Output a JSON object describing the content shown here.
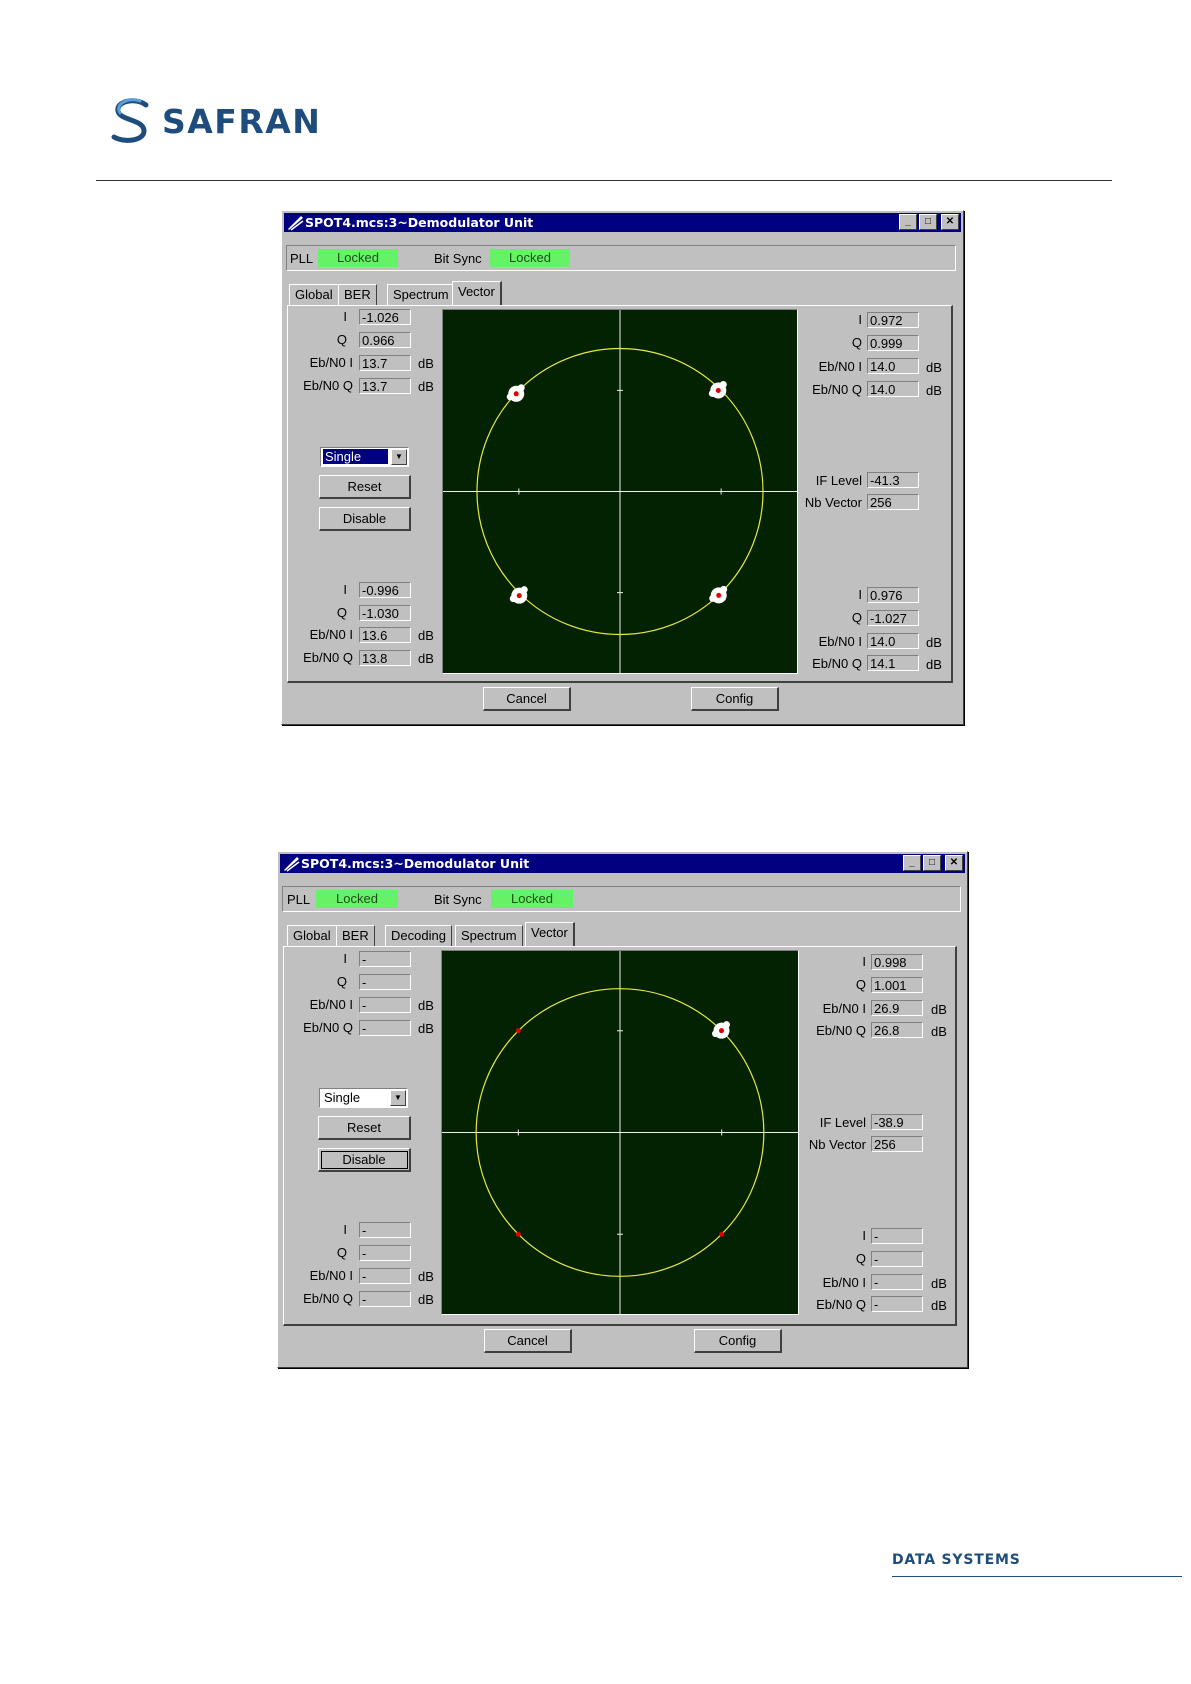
{
  "header": {
    "brand": "SAFRAN"
  },
  "footer": {
    "text": "DATA SYSTEMS"
  },
  "colors": {
    "plot_bg": "#022202",
    "circle": "#e8e840",
    "axis": "#f0f0f0",
    "cluster": "#ffffff",
    "point": "#e00000",
    "locked": "#66f266",
    "titlebar": "#000080"
  },
  "windows": [
    {
      "title": "SPOT4.mcs:3~Demodulator Unit",
      "pll_label": "PLL",
      "pll_status": "Locked",
      "bitsync_label": "Bit Sync",
      "bitsync_status": "Locked",
      "tabs": [
        "Global",
        "BER",
        "Spectrum",
        "Vector"
      ],
      "active_tab": "Vector",
      "top_left": {
        "i_label": "I",
        "i": "-1.026",
        "q_label": "Q",
        "q": "0.966",
        "ebi_label": "Eb/N0 I",
        "ebi": "13.7",
        "ebq_label": "Eb/N0 Q",
        "ebq": "13.7",
        "unit": "dB"
      },
      "top_right": {
        "i_label": "I",
        "i": "0.972",
        "q_label": "Q",
        "q": "0.999",
        "ebi_label": "Eb/N0 I",
        "ebi": "14.0",
        "ebq_label": "Eb/N0 Q",
        "ebq": "14.0",
        "unit": "dB"
      },
      "bottom_left": {
        "i_label": "I",
        "i": "-0.996",
        "q_label": "Q",
        "q": "-1.030",
        "ebi_label": "Eb/N0 I",
        "ebi": "13.6",
        "ebq_label": "Eb/N0 Q",
        "ebq": "13.8",
        "unit": "dB"
      },
      "bottom_right": {
        "i_label": "I",
        "i": "0.976",
        "q_label": "Q",
        "q": "-1.027",
        "ebi_label": "Eb/N0 I",
        "ebi": "14.0",
        "ebq_label": "Eb/N0 Q",
        "ebq": "14.1",
        "unit": "dB"
      },
      "mode_select": "Single",
      "reset_label": "Reset",
      "disable_label": "Disable",
      "if_level_label": "IF Level",
      "if_level": "-41.3",
      "nb_vector_label": "Nb Vector",
      "nb_vector": "256",
      "cancel_label": "Cancel",
      "config_label": "Config",
      "chart_data": {
        "type": "scatter",
        "title": "",
        "xlim": [
          -1.75,
          1.75
        ],
        "ylim": [
          -1.75,
          1.75
        ],
        "reference_circle_radius": 1.414,
        "points": [
          {
            "x": -1.026,
            "y": 0.966,
            "cluster": true
          },
          {
            "x": 0.972,
            "y": 0.999,
            "cluster": true
          },
          {
            "x": -0.996,
            "y": -1.03,
            "cluster": true
          },
          {
            "x": 0.976,
            "y": -1.027,
            "cluster": true
          }
        ]
      }
    },
    {
      "title": "SPOT4.mcs:3~Demodulator Unit",
      "pll_label": "PLL",
      "pll_status": "Locked",
      "bitsync_label": "Bit Sync",
      "bitsync_status": "Locked",
      "tabs": [
        "Global",
        "BER",
        "Decoding",
        "Spectrum",
        "Vector"
      ],
      "active_tab": "Vector",
      "top_left": {
        "i_label": "I",
        "i": "-",
        "q_label": "Q",
        "q": "-",
        "ebi_label": "Eb/N0 I",
        "ebi": "-",
        "ebq_label": "Eb/N0 Q",
        "ebq": "-",
        "unit": "dB"
      },
      "top_right": {
        "i_label": "I",
        "i": "0.998",
        "q_label": "Q",
        "q": "1.001",
        "ebi_label": "Eb/N0 I",
        "ebi": "26.9",
        "ebq_label": "Eb/N0 Q",
        "ebq": "26.8",
        "unit": "dB"
      },
      "bottom_left": {
        "i_label": "I",
        "i": "-",
        "q_label": "Q",
        "q": "-",
        "ebi_label": "Eb/N0 I",
        "ebi": "-",
        "ebq_label": "Eb/N0 Q",
        "ebq": "-",
        "unit": "dB"
      },
      "bottom_right": {
        "i_label": "I",
        "i": "-",
        "q_label": "Q",
        "q": "-",
        "ebi_label": "Eb/N0 I",
        "ebi": "-",
        "ebq_label": "Eb/N0 Q",
        "ebq": "-",
        "unit": "dB"
      },
      "mode_select": "Single",
      "reset_label": "Reset",
      "disable_label": "Disable",
      "if_level_label": "IF Level",
      "if_level": "-38.9",
      "nb_vector_label": "Nb Vector",
      "nb_vector": "256",
      "cancel_label": "Cancel",
      "config_label": "Config",
      "chart_data": {
        "type": "scatter",
        "title": "",
        "xlim": [
          -1.75,
          1.75
        ],
        "ylim": [
          -1.75,
          1.75
        ],
        "reference_circle_radius": 1.414,
        "points": [
          {
            "x": 0.998,
            "y": 1.001,
            "cluster": true
          },
          {
            "x": -1.0,
            "y": 1.0,
            "cluster": false
          },
          {
            "x": -1.0,
            "y": -1.0,
            "cluster": false
          },
          {
            "x": 1.0,
            "y": -1.0,
            "cluster": false
          }
        ]
      }
    }
  ]
}
